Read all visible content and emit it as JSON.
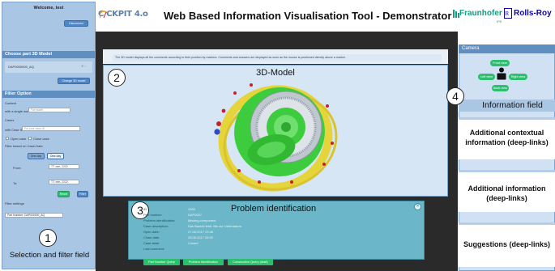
{
  "sidebar": {
    "welcome": "Welcome, test",
    "disconnect": "Disconnect",
    "choose_title": "Choose part 3D Model",
    "model_value": "DAP0000000_AQ",
    "change_btn": "Change 3D model",
    "filter_title": "Filter Option",
    "content_label": "Content",
    "single_word_label": "with a single word",
    "single_word_placeholder": "Fat model",
    "cases_label": "Cases",
    "case_id_label": "with Case ID",
    "case_id_placeholder": "Put your case-ID",
    "open_case": "Open case",
    "close_case": "Close case",
    "date_filter_label": "Filter based on Case-Date",
    "one_day_a": "One day",
    "one_day_b": "One day",
    "from_label": "From:",
    "from_value": "TT. mm. 2222",
    "to_label": "To:",
    "to_value": "TT. mm. 2222",
    "reset_btn": "Reset",
    "filter_btn": "Filter",
    "filter_settings_label": "Filter settings",
    "part_number_value": "Part Number: DAP000000_AQ",
    "marker_num": "1",
    "marker_caption": "Selection and filter field"
  },
  "header": {
    "logo": "C  CKPIT 4.o",
    "title": "Web Based Information Visualisation Tool - Demonstrator",
    "fraunhofer": "Fraunhofer",
    "fraunhofer_sub": "IPK",
    "rolls": "Rolls-Roy"
  },
  "main": {
    "info_text": "The 3D model displays all the comments according to their position by markers. Comments and answers are displayed as soon as the mouse is positioned directly above a marker.",
    "model_title": "3D-Model",
    "marker2": "2",
    "marker3": "3",
    "problem": {
      "title": "Problem identification",
      "rows": [
        {
          "label": "ID:",
          "value": "1000"
        },
        {
          "label": "Part number:",
          "value": "DAP0007"
        },
        {
          "label": "Problem identification:",
          "value": "Missing component"
        },
        {
          "label": "Case description:",
          "value": "Das Bauteil fehlt. Bis zur Lieferdatum"
        },
        {
          "label": "Open date:",
          "value": "27.06.2017 23:46"
        },
        {
          "label": "Close date:",
          "value": "28.06.2017 08:02"
        },
        {
          "label": "Case state:",
          "value": "Closed"
        },
        {
          "label": "Last comment:",
          "value": ""
        }
      ],
      "buttons": [
        "Part Number Query",
        "Problem Identification",
        "Consecutive Query (draft)"
      ]
    }
  },
  "right": {
    "camera_title": "Camera",
    "front_view": "Front view",
    "left_view": "Left view",
    "right_view": "Right view",
    "back_view": "Back view",
    "marker4": "4",
    "info_field": "Information field",
    "box1": "Additional contextual information (deep-links)",
    "box2": "Additional information (deep-links)",
    "box3": "Suggestions (deep-links)"
  },
  "colors": {
    "sidebar_bg": "#a9c6e4",
    "header_bar": "#5f8fc1",
    "main_bg": "#2a2a2a",
    "problem_panel": "#6bb6c8",
    "action_green": "#2bbf6e",
    "model_green": "#3dcc3d",
    "model_yellow": "#e5d43a"
  }
}
